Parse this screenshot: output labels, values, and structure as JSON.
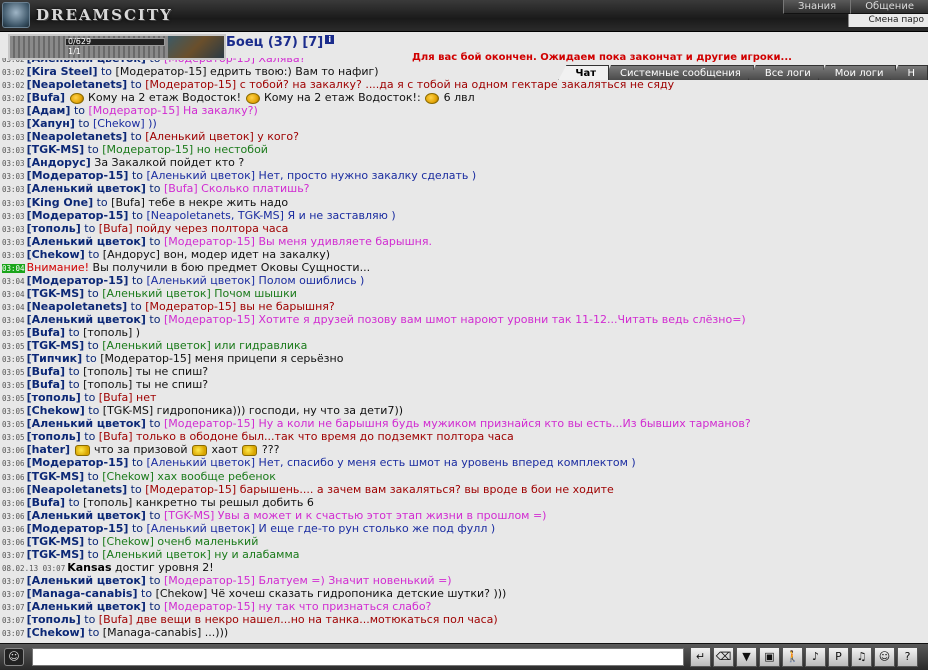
{
  "logo": {
    "text": "DREAMSCITY"
  },
  "topmenu": {
    "items": [
      "Знания",
      "Общение"
    ],
    "submenu": "Смена паро"
  },
  "player": {
    "hp": "0/629",
    "mana": "1/1",
    "hp_fraction": 0
  },
  "fighter": {
    "label": "Боец (37) [7]",
    "box": "i"
  },
  "battle_message": "Для вас бой окончен. Ожидаем пока закончат и другие игроки...",
  "tabs": [
    "Чат",
    "Системные сообщения",
    "Все логи",
    "Мои логи",
    "Н"
  ],
  "messages": [
    {
      "time": "03:02",
      "nick": "[Аленький цветок]",
      "to": "to",
      "target": "[Модератор-15]",
      "text": " Халява?",
      "color": "magenta"
    },
    {
      "time": "03:02",
      "nick": "[Kira Steel]",
      "to": "to",
      "target": "[Модератор-15]",
      "text": " едрить твою:) Вам то нафиг)",
      "color": "black"
    },
    {
      "time": "03:02",
      "nick": "[Neapoletanets]",
      "to": "to",
      "target": "[Модератор-15]",
      "text": " с тобой? на закалку? ....да я с тобой на одном гектаре закаляться не сяду",
      "color": "red"
    },
    {
      "time": "03:02",
      "nick": "[Bufa]",
      "to": "",
      "target": "",
      "text": "Кому на 2 етаж Водосток!",
      "text2": "Кому на 2 етаж Водосток!:",
      "text3": "6 лвл",
      "color": "black",
      "smiles": true
    },
    {
      "time": "03:03",
      "nick": "[Адам]",
      "to": "to",
      "target": "[Модератор-15]",
      "text": " На закалку?)",
      "color": "magenta"
    },
    {
      "time": "03:03",
      "nick": "[Хапун]",
      "to": "to",
      "target": "[Chekow]",
      "text": " ))",
      "color": "blue"
    },
    {
      "time": "03:03",
      "nick": "[Neapoletanets]",
      "to": "to",
      "target": "[Аленький цветок]",
      "text": " у кого?",
      "color": "red"
    },
    {
      "time": "03:03",
      "nick": "[TGK-MS]",
      "to": "to",
      "target": "[Модератор-15]",
      "text": " но нестобой",
      "color": "green"
    },
    {
      "time": "03:03",
      "nick": "[Андорус]",
      "to": "",
      "target": "",
      "text": "За Закалкой пойдет кто ?",
      "color": "black"
    },
    {
      "time": "03:03",
      "nick": "[Модератор-15]",
      "to": "to",
      "target": "[Аленький цветок]",
      "text": " Нет, просто нужно закалку сделать )",
      "color": "blue"
    },
    {
      "time": "03:03",
      "nick": "[Аленький цветок]",
      "to": "to",
      "target": "[Bufa]",
      "text": " Сколько платишь?",
      "color": "magenta"
    },
    {
      "time": "03:03",
      "nick": "[King One]",
      "to": "to",
      "target": "[Bufa]",
      "text": " тебе в некре жить надо",
      "color": "black"
    },
    {
      "time": "03:03",
      "nick": "[Модератор-15]",
      "to": "to",
      "target": "[Neapoletanets, TGK-MS]",
      "text": " Я и не заставляю )",
      "color": "blue"
    },
    {
      "time": "03:03",
      "nick": "[тополь]",
      "to": "to",
      "target": "[Bufa]",
      "text": " пойду через полтора часа",
      "color": "red"
    },
    {
      "time": "03:03",
      "nick": "[Аленький цветок]",
      "to": "to",
      "target": "[Модератор-15]",
      "text": " Вы меня удивляете барышня.",
      "color": "magenta"
    },
    {
      "time": "03:03",
      "nick": "[Chekow]",
      "to": "to",
      "target": "[Андорус]",
      "text": " вон, модер идет на закалку)",
      "color": "black"
    },
    {
      "time": "03:04",
      "system": true,
      "prefix": "Внимание!",
      "text": " Вы получили в бою предмет Оковы Сущности...",
      "color": "black"
    },
    {
      "time": "03:04",
      "nick": "[Модератор-15]",
      "to": "to",
      "target": "[Аленький цветок]",
      "text": " Полом ошиблись )",
      "color": "blue"
    },
    {
      "time": "03:04",
      "nick": "[TGK-MS]",
      "to": "to",
      "target": "[Аленький цветок]",
      "text": " Почом шышки",
      "color": "green"
    },
    {
      "time": "03:04",
      "nick": "[Neapoletanets]",
      "to": "to",
      "target": "[Модератор-15]",
      "text": " вы не барышня?",
      "color": "red"
    },
    {
      "time": "03:04",
      "nick": "[Аленький цветок]",
      "to": "to",
      "target": "[Модератор-15]",
      "text": " Хотите я друзей позову вам шмот нароют уровни так 11-12...Читать ведь слёзно=)",
      "color": "magenta"
    },
    {
      "time": "03:05",
      "nick": "[Bufa]",
      "to": "to",
      "target": "[тополь]",
      "text": " )",
      "color": "black"
    },
    {
      "time": "03:05",
      "nick": "[TGK-MS]",
      "to": "to",
      "target": "[Аленький цветок]",
      "text": " или гидравлика",
      "color": "green"
    },
    {
      "time": "03:05",
      "nick": "[Типчик]",
      "to": "to",
      "target": "[Модератор-15]",
      "text": " меня прицепи я серьёзно",
      "color": "black"
    },
    {
      "time": "03:05",
      "nick": "[Bufa]",
      "to": "to",
      "target": "[тополь]",
      "text": " ты не спиш?",
      "color": "black"
    },
    {
      "time": "03:05",
      "nick": "[Bufa]",
      "to": "to",
      "target": "[тополь]",
      "text": " ты не спиш?",
      "color": "black"
    },
    {
      "time": "03:05",
      "nick": "[тополь]",
      "to": "to",
      "target": "[Bufa]",
      "text": " нет",
      "color": "red"
    },
    {
      "time": "03:05",
      "nick": "[Chekow]",
      "to": "to",
      "target": "[TGK-MS]",
      "text": " гидропоника))) господи, ну что за дети7))",
      "color": "black"
    },
    {
      "time": "03:05",
      "nick": "[Аленький цветок]",
      "to": "to",
      "target": "[Модератор-15]",
      "text": " Ну а коли не барышня будь мужиком признайся кто вы есть...Из бывших тарманов?",
      "color": "magenta"
    },
    {
      "time": "03:05",
      "nick": "[тополь]",
      "to": "to",
      "target": "[Bufa]",
      "text": " только в ободоне был...так что время до подземкт полтора часа",
      "color": "red"
    },
    {
      "time": "03:06",
      "nick": "[hater]",
      "to": "",
      "target": "",
      "text": "что за призовой",
      "text2": "хаот",
      "text3": "???",
      "color": "black",
      "smiles": true
    },
    {
      "time": "03:06",
      "nick": "[Модератор-15]",
      "to": "to",
      "target": "[Аленький цветок]",
      "text": " Нет, спасибо у меня есть шмот на уровень вперед комплектом )",
      "color": "blue"
    },
    {
      "time": "03:06",
      "nick": "[TGK-MS]",
      "to": "to",
      "target": "[Chekow]",
      "text": " хах вообще ребенок",
      "color": "green"
    },
    {
      "time": "03:06",
      "nick": "[Neapoletanets]",
      "to": "to",
      "target": "[Модератор-15]",
      "text": " барышень.... а зачем вам закаляться? вы вроде в бои не ходите",
      "color": "red"
    },
    {
      "time": "03:06",
      "nick": "[Bufa]",
      "to": "to",
      "target": "[тополь]",
      "text": " канкретно ты решыл добить 6",
      "color": "black"
    },
    {
      "time": "03:06",
      "nick": "[Аленький цветок]",
      "to": "to",
      "target": "[TGK-MS]",
      "text": " Увы а может и к счастью этот этап жизни в прошлом =)",
      "color": "magenta"
    },
    {
      "time": "03:06",
      "nick": "[Модератор-15]",
      "to": "to",
      "target": "[Аленький цветок]",
      "text": " И еще где-то рун столько же под фулл )",
      "color": "blue"
    },
    {
      "time": "03:06",
      "nick": "[TGK-MS]",
      "to": "to",
      "target": "[Chekow]",
      "text": " оченб маленький",
      "color": "green"
    },
    {
      "time": "03:07",
      "nick": "[TGK-MS]",
      "to": "to",
      "target": "[Аленький цветок]",
      "text": " ну и алабамма",
      "color": "green"
    },
    {
      "time": "08.02.13 03:07",
      "level": true,
      "nick": "Kansas",
      "text": " достиг уровня 2!",
      "color": "black"
    },
    {
      "time": "03:07",
      "nick": "[Аленький цветок]",
      "to": "to",
      "target": "[Модератор-15]",
      "text": " Блатуем =) Значит новенький =)",
      "color": "magenta"
    },
    {
      "time": "03:07",
      "nick": "[Managa-canabis]",
      "to": "to",
      "target": "[Chekow]",
      "text": " Чё хочеш сказать гидропоника детские шутки? )))",
      "color": "black"
    },
    {
      "time": "03:07",
      "nick": "[Аленький цветок]",
      "to": "to",
      "target": "[Модератор-15]",
      "text": " ну так что признаться слабо?",
      "color": "magenta"
    },
    {
      "time": "03:07",
      "nick": "[тополь]",
      "to": "to",
      "target": "[Bufa]",
      "text": " две вещи в некро нашел...но на танка...мотюкаться пол часа)",
      "color": "red"
    },
    {
      "time": "03:07",
      "nick": "[Chekow]",
      "to": "to",
      "target": "[Managa-canabis]",
      "text": " ...)))",
      "color": "black"
    }
  ],
  "input": {
    "value": "",
    "placeholder": ""
  },
  "toolbar": [
    "send-icon",
    "eraser-icon",
    "filter-icon",
    "save-icon",
    "walk-icon",
    "sound-icon",
    "p-l-icon",
    "music-icon",
    "smile-icon",
    "help-icon"
  ],
  "toolbar_glyphs": [
    "↵",
    "⌫",
    "▼",
    "▣",
    "🚶",
    "♪",
    "P",
    "♫",
    "☺",
    "?"
  ]
}
